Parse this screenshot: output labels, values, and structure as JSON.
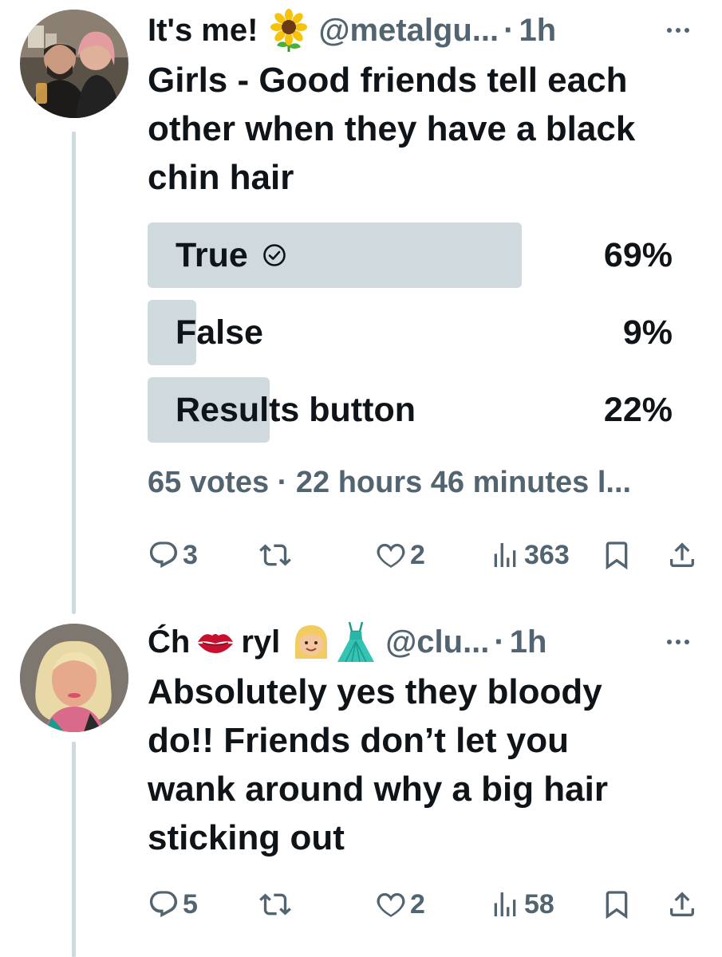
{
  "tweets": [
    {
      "name": "It's me!",
      "emoji_icons": [
        "sunflower-icon"
      ],
      "handle": "@metalgu...",
      "separator": "·",
      "time": "1h",
      "text_lines": [
        "Girls - Good friends tell each",
        "other when they have a black",
        "chin hair"
      ],
      "poll": {
        "options": [
          {
            "label": "True",
            "percent_label": "69%",
            "percent": 69,
            "selected": true
          },
          {
            "label": "False",
            "percent_label": "9%",
            "percent": 9,
            "selected": false
          },
          {
            "label": "Results button",
            "percent_label": "22%",
            "percent": 22,
            "selected": false
          }
        ],
        "meta": "65 votes · 22 hours 46 minutes l..."
      },
      "actions": {
        "replies": "3",
        "retweets": "",
        "likes": "2",
        "views": "363"
      }
    },
    {
      "name_parts": [
        "Ćh",
        "ryl"
      ],
      "emoji_icons": [
        "kiss-mark-icon",
        "blonde-woman-icon",
        "dress-icon"
      ],
      "handle": "@clu...",
      "separator": "·",
      "time": "1h",
      "text_lines": [
        "Absolutely yes they bloody",
        "do!! Friends don’t let you",
        "wank around why a big hair",
        "sticking out"
      ],
      "actions": {
        "replies": "5",
        "retweets": "",
        "likes": "2",
        "views": "58"
      }
    }
  ],
  "colors": {
    "text": "#0f1419",
    "secondary": "#536471",
    "poll_fill": "#cfd9de",
    "thread_line": "#cfd9de"
  }
}
